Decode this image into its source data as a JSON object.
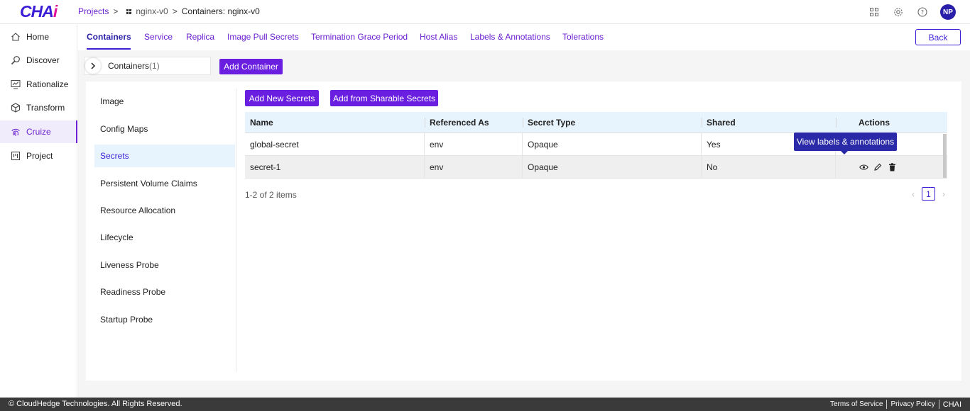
{
  "app": {
    "logo_main": "CHA",
    "logo_accent": "i",
    "avatar": "NP"
  },
  "breadcrumb": {
    "projects": "Projects",
    "project": "nginx-v0",
    "current": "Containers: nginx-v0"
  },
  "sidebar": {
    "items": [
      {
        "label": "Home",
        "icon": "home-icon"
      },
      {
        "label": "Discover",
        "icon": "discover-icon"
      },
      {
        "label": "Rationalize",
        "icon": "rationalize-icon"
      },
      {
        "label": "Transform",
        "icon": "cube-icon"
      },
      {
        "label": "Cruize",
        "icon": "fingerprint-icon",
        "active": true
      },
      {
        "label": "Project",
        "icon": "project-icon"
      }
    ]
  },
  "tabs": [
    {
      "label": "Containers",
      "active": true
    },
    {
      "label": "Service"
    },
    {
      "label": "Replica"
    },
    {
      "label": "Image Pull Secrets"
    },
    {
      "label": "Termination Grace Period"
    },
    {
      "label": "Host Alias"
    },
    {
      "label": "Labels & Annotations"
    },
    {
      "label": "Tolerations"
    }
  ],
  "back_label": "Back",
  "containers": {
    "label": "Containers",
    "count": "(1)",
    "add_label": "Add Container"
  },
  "left_menu": [
    {
      "label": "Image"
    },
    {
      "label": "Config Maps"
    },
    {
      "label": "Secrets",
      "active": true
    },
    {
      "label": "Persistent Volume Claims"
    },
    {
      "label": "Resource Allocation"
    },
    {
      "label": "Lifecycle"
    },
    {
      "label": "Liveness Probe"
    },
    {
      "label": "Readiness Probe"
    },
    {
      "label": "Startup Probe"
    }
  ],
  "secrets": {
    "add_new_label": "Add New Secrets",
    "add_sharable_label": "Add from Sharable Secrets",
    "columns": [
      "Name",
      "Referenced As",
      "Secret Type",
      "Shared",
      "Actions"
    ],
    "rows": [
      {
        "name": "global-secret",
        "referenced_as": "env",
        "secret_type": "Opaque",
        "shared": "Yes"
      },
      {
        "name": "secret-1",
        "referenced_as": "env",
        "secret_type": "Opaque",
        "shared": "No"
      }
    ],
    "tooltip": "View labels & annotations",
    "pagination_info": "1-2 of 2 items",
    "current_page": "1"
  },
  "footer": {
    "copyright": "© CloudHedge Technologies. All Rights Reserved.",
    "terms": "Terms of Service",
    "privacy": "Privacy Policy",
    "brand": "CHAI"
  },
  "colors": {
    "primary": "#6a1fe0",
    "accent": "#3b1fd6",
    "active_bg": "#e8f4fd",
    "tooltip": "#2a2aa8"
  }
}
